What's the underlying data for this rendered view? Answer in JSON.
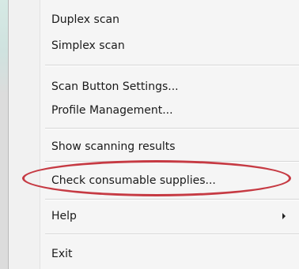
{
  "menu": {
    "items": [
      {
        "label": "Duplex scan"
      },
      {
        "label": "Simplex scan"
      },
      {
        "label": "Scan Button Settings..."
      },
      {
        "label": "Profile Management..."
      },
      {
        "label": "Show scanning results"
      },
      {
        "label": "Check consumable supplies..."
      },
      {
        "label": "Help",
        "submenu_icon": "chevron-right-icon"
      },
      {
        "label": "Exit"
      }
    ],
    "highlighted_item": "Check consumable supplies...",
    "highlight_color": "#c63a43"
  }
}
